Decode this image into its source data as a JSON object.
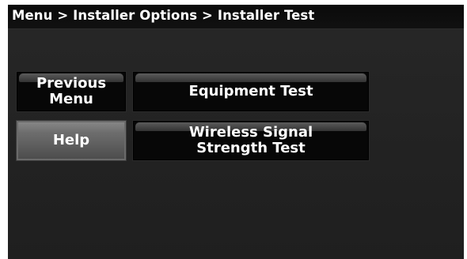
{
  "breadcrumb": {
    "text": "Menu > Installer Options > Installer Test"
  },
  "buttons": {
    "previous_menu": "Previous\nMenu",
    "help": "Help",
    "equipment_test": "Equipment Test",
    "wireless_signal_test": "Wireless Signal\nStrength Test"
  },
  "colors": {
    "background": "#242424",
    "header": "#0d0d0d",
    "button_dark": "#070707",
    "button_highlight": "#6a6a6a",
    "button_light": "#6d6d6d",
    "text": "#ffffff"
  }
}
